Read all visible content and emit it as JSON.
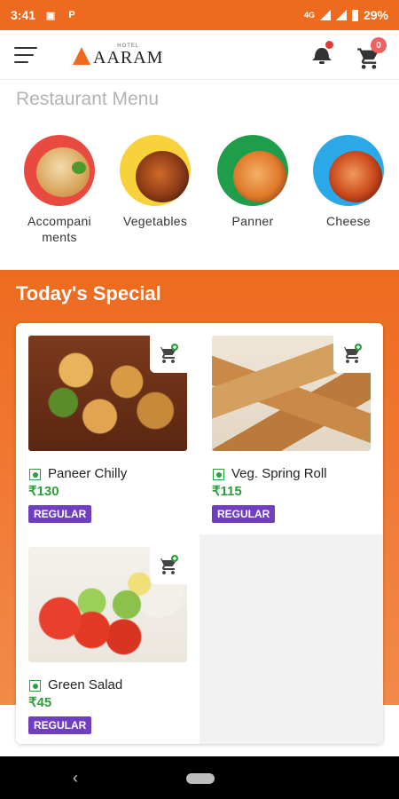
{
  "status_bar": {
    "time": "3:41",
    "network": "4G",
    "battery": "29%"
  },
  "app_bar": {
    "logo_small": "HOTEL",
    "logo_name": "AARAM",
    "cart_count": "0"
  },
  "restaurant_menu": {
    "title": "Restaurant Menu",
    "categories": [
      {
        "label": "Accompani\nments"
      },
      {
        "label": "Vegetables"
      },
      {
        "label": "Panner"
      },
      {
        "label": "Cheese"
      }
    ]
  },
  "todays_special": {
    "title": "Today's Special",
    "dishes": [
      {
        "name": "Paneer Chilly",
        "price": "₹130",
        "tag": "REGULAR"
      },
      {
        "name": "Veg. Spring Roll",
        "price": "₹115",
        "tag": "REGULAR"
      },
      {
        "name": "Green Salad",
        "price": "₹45",
        "tag": "REGULAR"
      }
    ]
  },
  "colors": {
    "brand": "#ee6a1e",
    "veg_green": "#2e9d3c",
    "tag_purple": "#6f3fbf"
  },
  "icons": [
    "menu-icon",
    "bell-icon",
    "cart-icon",
    "add-to-cart-icon",
    "back-icon",
    "home-icon"
  ]
}
